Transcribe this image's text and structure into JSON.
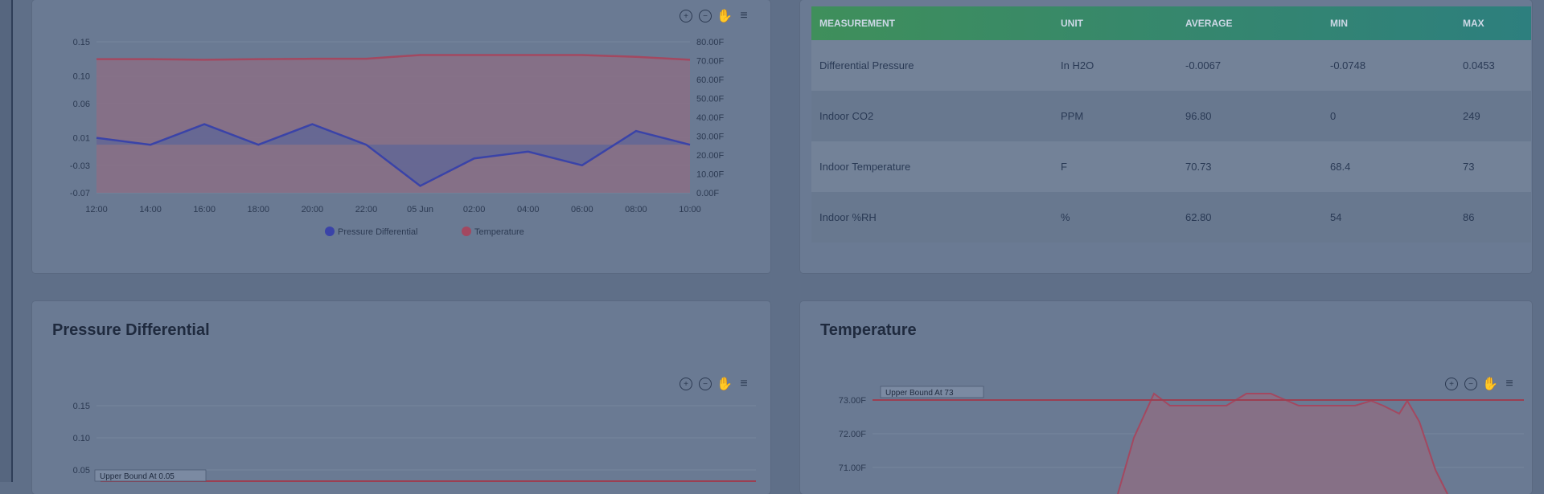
{
  "toolbar_icons": [
    "zoom-in-icon",
    "zoom-out-icon",
    "pan-icon",
    "menu-icon"
  ],
  "combined_chart": {
    "left_ticks": [
      "0.15",
      "0.10",
      "0.06",
      "0.01",
      "-0.03",
      "-0.07"
    ],
    "right_ticks": [
      "80.00F",
      "70.00F",
      "60.00F",
      "50.00F",
      "40.00F",
      "30.00F",
      "20.00F",
      "10.00F",
      "0.00F"
    ],
    "x_ticks": [
      "12:00",
      "14:00",
      "16:00",
      "18:00",
      "20:00",
      "22:00",
      "05 Jun",
      "02:00",
      "04:00",
      "06:00",
      "08:00",
      "10:00"
    ],
    "legend": [
      "Pressure Differential",
      "Temperature"
    ]
  },
  "table": {
    "headers": [
      "MEASUREMENT",
      "UNIT",
      "AVERAGE",
      "MIN",
      "MAX"
    ],
    "rows": [
      [
        "Differential Pressure",
        "In H2O",
        "-0.0067",
        "-0.0748",
        "0.0453"
      ],
      [
        "Indoor CO2",
        "PPM",
        "96.80",
        "0",
        "249"
      ],
      [
        "Indoor Temperature",
        "F",
        "70.73",
        "68.4",
        "73"
      ],
      [
        "Indoor %RH",
        "%",
        "62.80",
        "54",
        "86"
      ]
    ]
  },
  "pressure_panel": {
    "title": "Pressure Differential",
    "y_ticks": [
      "0.15",
      "0.10",
      "0.05"
    ],
    "bound_label": "Upper Bound At 0.05"
  },
  "temperature_panel": {
    "title": "Temperature",
    "y_ticks": [
      "73.00F",
      "72.00F",
      "71.00F"
    ],
    "bound_label": "Upper Bound At 73"
  },
  "chart_data": [
    {
      "type": "line",
      "title": "",
      "x": [
        "12:00",
        "14:00",
        "16:00",
        "18:00",
        "20:00",
        "22:00",
        "05 Jun",
        "02:00",
        "04:00",
        "06:00",
        "08:00",
        "10:00"
      ],
      "series": [
        {
          "name": "Pressure Differential",
          "axis": "left",
          "values": [
            0.01,
            0.0,
            0.03,
            0.0,
            0.03,
            0.0,
            -0.06,
            -0.02,
            -0.01,
            -0.03,
            0.02,
            0.0
          ]
        },
        {
          "name": "Temperature",
          "axis": "right",
          "values": [
            70.8,
            70.8,
            70.5,
            70.8,
            71.0,
            71.0,
            73.0,
            73.0,
            73.0,
            73.0,
            72.0,
            70.5
          ]
        }
      ],
      "ylim_left": [
        -0.07,
        0.15
      ],
      "ylim_right": [
        0,
        80
      ],
      "legend_position": "bottom"
    }
  ]
}
